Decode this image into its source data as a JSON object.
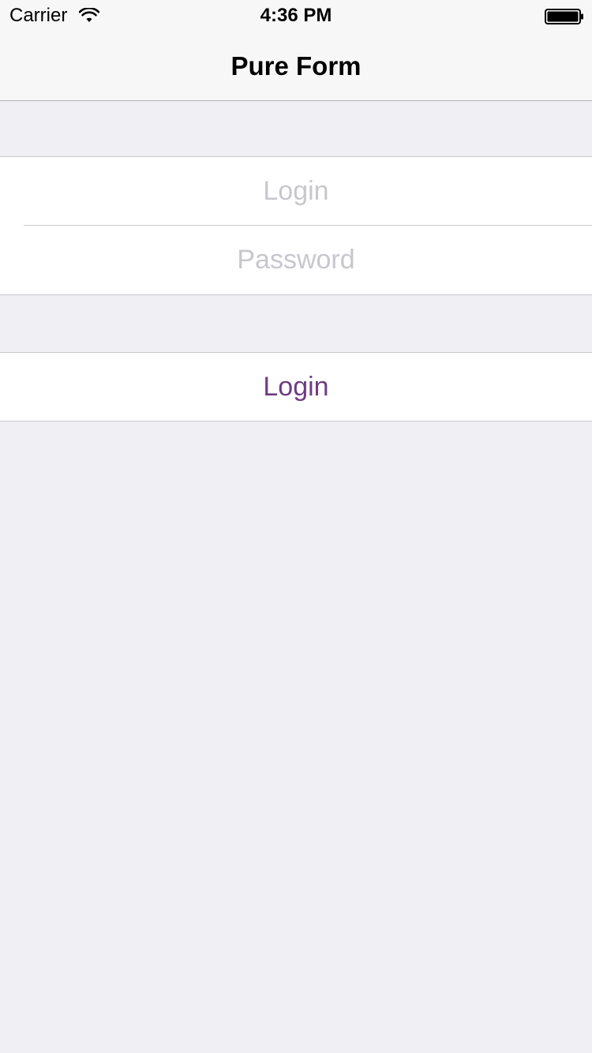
{
  "status_bar": {
    "carrier": "Carrier",
    "time": "4:36 PM",
    "wifi_icon": "wifi-icon",
    "battery_icon": "battery-full-icon"
  },
  "nav": {
    "title": "Pure Form"
  },
  "form": {
    "login_field": {
      "value": "",
      "placeholder": "Login"
    },
    "password_field": {
      "value": "",
      "placeholder": "Password"
    }
  },
  "actions": {
    "login_label": "Login"
  },
  "colors": {
    "accent": "#6e3c82",
    "background": "#efeff4",
    "placeholder": "#c7c7cd",
    "separator": "#c8c7cc"
  }
}
